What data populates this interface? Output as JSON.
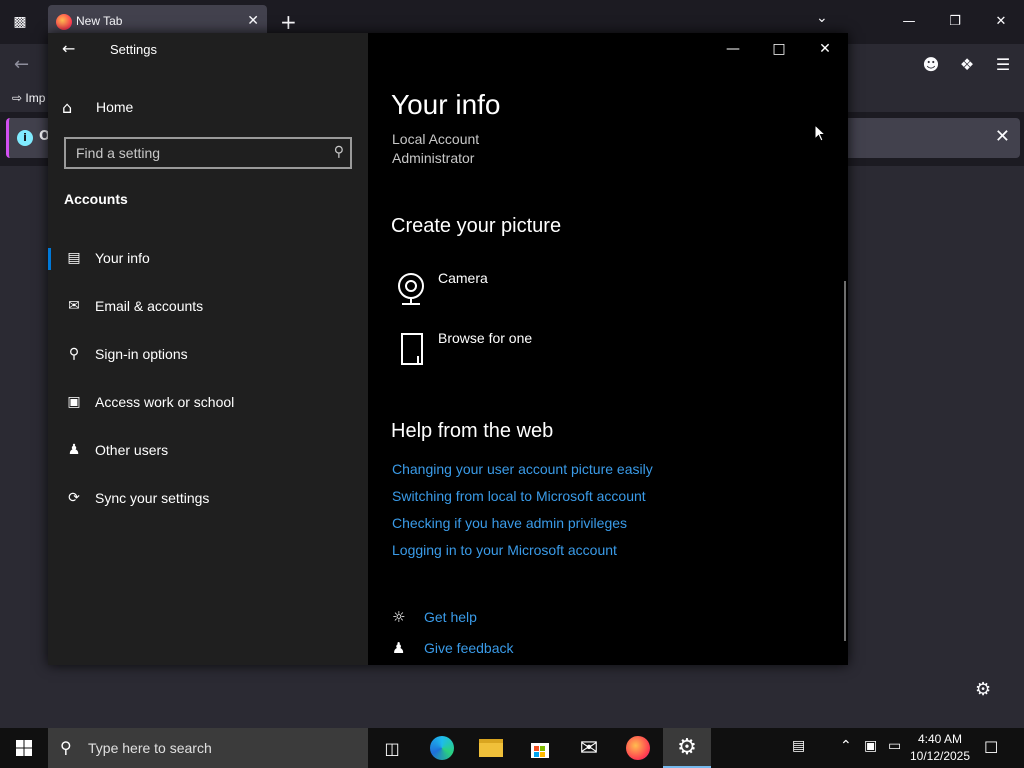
{
  "firefox": {
    "tab_title": "New Tab",
    "import_label": "Imp",
    "notice_text": "O"
  },
  "settings": {
    "window_title": "Settings",
    "home_label": "Home",
    "search_placeholder": "Find a setting",
    "section_heading": "Accounts",
    "nav_items": [
      {
        "label": "Your info",
        "icon": "person-card-icon",
        "selected": true
      },
      {
        "label": "Email & accounts",
        "icon": "mail-icon",
        "selected": false
      },
      {
        "label": "Sign-in options",
        "icon": "key-icon",
        "selected": false
      },
      {
        "label": "Access work or school",
        "icon": "briefcase-icon",
        "selected": false
      },
      {
        "label": "Other users",
        "icon": "person-add-icon",
        "selected": false
      },
      {
        "label": "Sync your settings",
        "icon": "sync-icon",
        "selected": false
      }
    ],
    "page_title": "Your info",
    "account_type": "Local Account",
    "account_role": "Administrator",
    "create_picture_heading": "Create your picture",
    "camera_label": "Camera",
    "browse_label": "Browse for one",
    "help_heading": "Help from the web",
    "help_links": [
      "Changing your user account picture easily",
      "Switching from local to Microsoft account",
      "Checking if you have admin privileges",
      "Logging in to your Microsoft account"
    ],
    "get_help_label": "Get help",
    "feedback_label": "Give feedback"
  },
  "taskbar": {
    "search_placeholder": "Type here to search",
    "time": "4:40 AM",
    "date": "10/12/2025"
  },
  "colors": {
    "accent": "#0078d7",
    "link": "#3a9be8"
  }
}
